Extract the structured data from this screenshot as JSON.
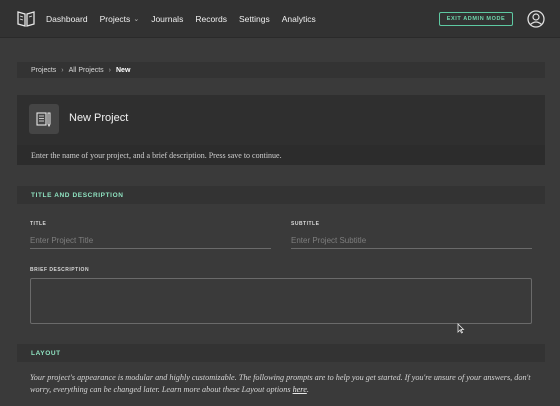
{
  "nav": {
    "items": [
      {
        "label": "Dashboard"
      },
      {
        "label": "Projects",
        "has_dropdown": true
      },
      {
        "label": "Journals"
      },
      {
        "label": "Records"
      },
      {
        "label": "Settings"
      },
      {
        "label": "Analytics"
      }
    ],
    "exit_label": "EXIT ADMIN MODE",
    "logo_icon": "book-icon",
    "avatar_icon": "user-avatar-icon"
  },
  "breadcrumb": {
    "items": [
      "Projects",
      "All Projects",
      "New"
    ]
  },
  "header": {
    "title": "New Project",
    "icon": "project-document-icon",
    "instructions": "Enter the name of your project, and a brief description. Press save to continue."
  },
  "sections": {
    "title_desc": "TITLE AND DESCRIPTION",
    "layout": "LAYOUT"
  },
  "form": {
    "title_label": "TITLE",
    "title_placeholder": "Enter Project Title",
    "subtitle_label": "SUBTITLE",
    "subtitle_placeholder": "Enter Project Subtitle",
    "brief_label": "BRIEF DESCRIPTION",
    "brief_value": ""
  },
  "layout": {
    "text": "Your project's appearance is modular and highly customizable. The following prompts are to help you get started. If you're unsure of your answers, don't worry, everything can be changed later. Learn more about these Layout options",
    "link": "here",
    "end": "."
  },
  "colors": {
    "accent": "#6fd6ad",
    "background": "#3a3a3a",
    "panel": "#2f2f2f"
  }
}
